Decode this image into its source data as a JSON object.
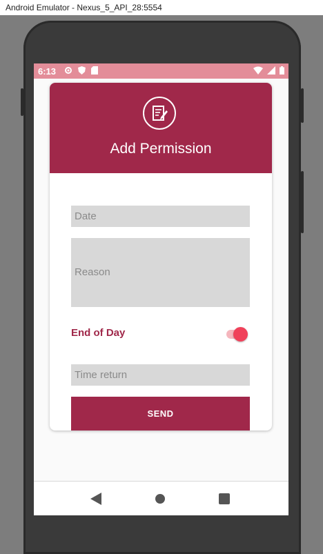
{
  "window": {
    "title": "Android Emulator - Nexus_5_API_28:5554"
  },
  "statusbar": {
    "time": "6:13",
    "icons": [
      "settings-icon",
      "shield-icon",
      "sd-card-icon"
    ],
    "right_icons": [
      "wifi-icon",
      "signal-icon",
      "battery-icon"
    ]
  },
  "card": {
    "header_icon": "edit-note-icon",
    "title": "Add Permission",
    "fields": {
      "date_placeholder": "Date",
      "reason_placeholder": "Reason",
      "time_return_placeholder": "Time return"
    },
    "end_of_day": {
      "label": "End of Day",
      "checked": true
    },
    "send_label": "SEND"
  },
  "navbar": {
    "icons": [
      "back-icon",
      "home-icon",
      "recents-icon"
    ]
  },
  "colors": {
    "accent": "#a0284a",
    "statusbar": "#e38d99",
    "toggle_knob": "#f0415a",
    "field_bg": "#d8d8d8"
  }
}
